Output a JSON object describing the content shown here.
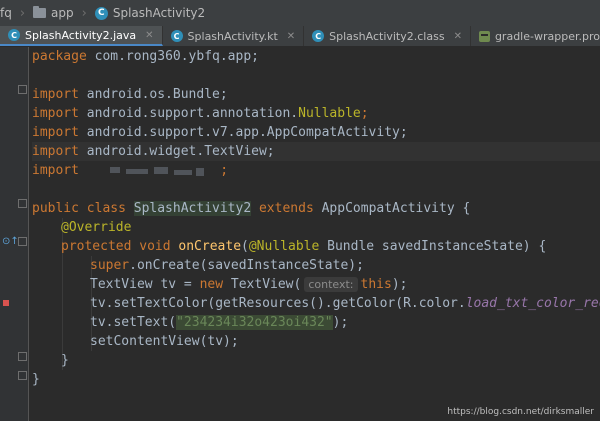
{
  "breadcrumb": {
    "items": [
      {
        "label": "fq"
      },
      {
        "label": "app"
      },
      {
        "label": "SplashActivity2"
      }
    ]
  },
  "tabs": [
    {
      "label": "SplashActivity2.java",
      "active": true
    },
    {
      "label": "SplashActivity.kt",
      "active": false
    },
    {
      "label": "SplashActivity2.class",
      "active": false
    },
    {
      "label": "gradle-wrapper.properties",
      "active": false
    }
  ],
  "code": {
    "package_kw": "package",
    "package_name": " com.rong360.ybfq.app;",
    "import_kw": "import",
    "imports": [
      " android.os.Bundle;",
      " android.support.annotation.",
      " android.support.v7.app.AppCompatActivity;",
      " android.widget.TextView;"
    ],
    "nullable": "Nullable",
    "semicolon": ";",
    "blurred_tail": ";",
    "public_class": "public class ",
    "class_name": "SplashActivity2",
    "extends_kw": " extends ",
    "super_class": "AppCompatActivity {",
    "override": "@Override",
    "protected_void": "protected void ",
    "method_name": "onCreate",
    "method_params_open": "(",
    "at_nullable": "@Nullable",
    "method_params_rest": " Bundle savedInstanceState) {",
    "super_kw": "super",
    "super_call": ".onCreate(savedInstanceState);",
    "tv_decl": "TextView tv = ",
    "new_kw": "new",
    "tv_ctor": " TextView(",
    "hint_context": "context:",
    "this_kw": "this",
    "tv_ctor_end": ");",
    "set_color_start": "tv.setTextColor(getResources().getColor(R.color.",
    "color_field": "load_txt_color_red",
    "set_color_end": "));",
    "set_text_start": "tv.setText(",
    "set_text_str": "\"234234i32o423oi432\"",
    "set_text_end": ");",
    "set_content": "setContentView(tv);",
    "close_method": "}",
    "close_class": "}"
  },
  "watermark": "https://blog.csdn.net/dirksmaller"
}
